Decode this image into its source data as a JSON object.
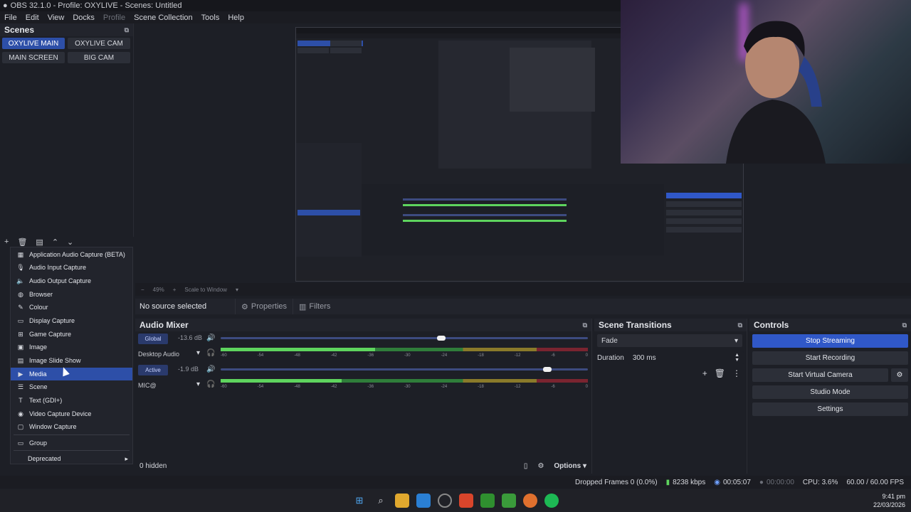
{
  "window": {
    "title": "OBS 32.1.0 - Profile: OXYLIVE - Scenes: Untitled"
  },
  "menu": {
    "items": [
      "File",
      "Edit",
      "View",
      "Docks",
      "Profile",
      "Scene Collection",
      "Tools",
      "Help"
    ]
  },
  "scenes": {
    "title": "Scenes",
    "items": [
      "OXYLIVE MAIN",
      "OXYLIVE CAM",
      "MAIN SCREEN",
      "BIG CAM"
    ],
    "active_index": 0
  },
  "add_source_menu": {
    "items": [
      {
        "label": "Application Audio Capture (BETA)",
        "icon": "app-audio-icon"
      },
      {
        "label": "Audio Input Capture",
        "icon": "microphone-icon"
      },
      {
        "label": "Audio Output Capture",
        "icon": "speaker-icon"
      },
      {
        "label": "Browser",
        "icon": "globe-icon"
      },
      {
        "label": "Colour",
        "icon": "brush-icon"
      },
      {
        "label": "Display Capture",
        "icon": "monitor-icon"
      },
      {
        "label": "Game Capture",
        "icon": "gamepad-icon"
      },
      {
        "label": "Image",
        "icon": "image-icon"
      },
      {
        "label": "Image Slide Show",
        "icon": "slideshow-icon"
      },
      {
        "label": "Media",
        "icon": "play-icon"
      },
      {
        "label": "Scene",
        "icon": "list-icon"
      },
      {
        "label": "Text (GDI+)",
        "icon": "text-icon"
      },
      {
        "label": "Video Capture Device",
        "icon": "camera-icon"
      },
      {
        "label": "Window Capture",
        "icon": "window-icon"
      }
    ],
    "group": "Group",
    "deprecated": "Deprecated",
    "hover_index": 9
  },
  "preview": {
    "zoom": "49%",
    "scale_mode": "Scale to Window"
  },
  "source_bar": {
    "no_source": "No source selected",
    "properties": "Properties",
    "filters": "Filters"
  },
  "audio_mixer": {
    "title": "Audio Mixer",
    "channels": [
      {
        "name": "Desktop Audio",
        "badge": "Global",
        "db": "-13.6 dB",
        "volume": 0.6,
        "level": 0.42
      },
      {
        "name": "MIC@",
        "badge": "Active",
        "db": "-1.9 dB",
        "volume": 0.89,
        "level": 0.33
      }
    ],
    "ticks": [
      "-60",
      "-54",
      "-48",
      "-42",
      "-36",
      "-30",
      "-24",
      "-18",
      "-12",
      "-6",
      "0"
    ],
    "hidden": "0 hidden",
    "options": "Options"
  },
  "scene_transitions": {
    "title": "Scene Transitions",
    "transition": "Fade",
    "duration_label": "Duration",
    "duration_value": "300 ms"
  },
  "controls": {
    "title": "Controls",
    "stop_streaming": "Stop Streaming",
    "start_recording": "Start Recording",
    "start_virtual_camera": "Start Virtual Camera",
    "studio_mode": "Studio Mode",
    "settings": "Settings"
  },
  "status": {
    "dropped_frames": "Dropped Frames 0 (0.0%)",
    "bitrate": "8238 kbps",
    "stream_time": "00:05:07",
    "rec_time": "00:00:00",
    "cpu": "CPU: 3.6%",
    "fps": "60.00 / 60.00 FPS"
  },
  "taskbar": {
    "time": "9:41 pm",
    "date": "22/03/2026"
  },
  "colors": {
    "accent": "#3058c8",
    "active_scene": "#2d4fa8"
  }
}
